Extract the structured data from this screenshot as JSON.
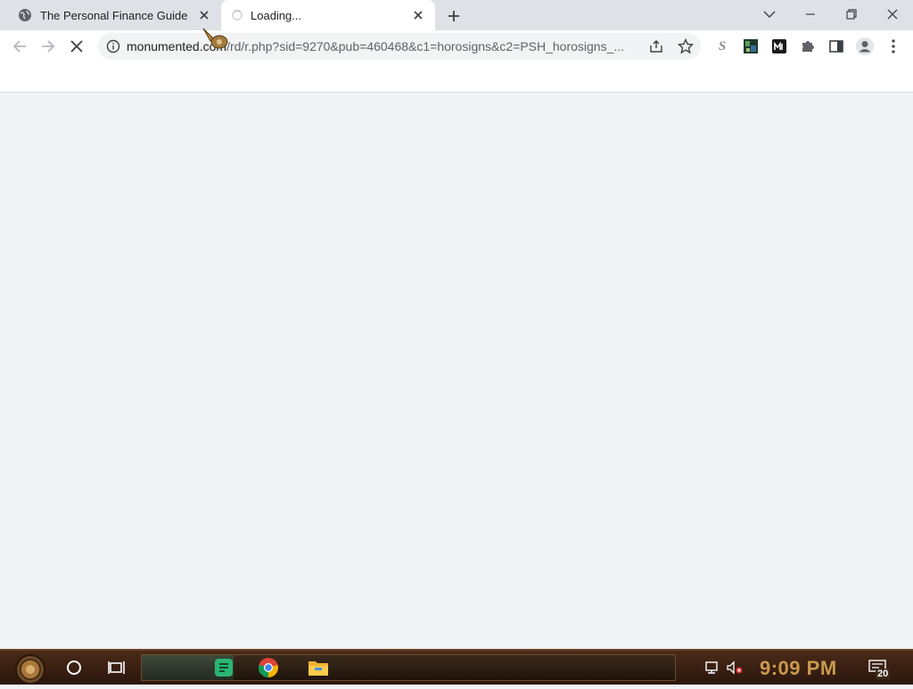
{
  "tabs": [
    {
      "title": "The Personal Finance Guide",
      "state": "inactive",
      "icon": "globe-icon"
    },
    {
      "title": "Loading...",
      "state": "active-loading",
      "icon": "loading-spinner"
    }
  ],
  "omnibox": {
    "host": "monumented.com",
    "path": "/rd/r.php?sid=9270&pub=460468&c1=horosigns&c2=PSH_horosigns_..."
  },
  "extensions": [
    "s-extension-icon",
    "image-extension-icon",
    "m-extension-icon",
    "puzzle-icon",
    "side-panel-icon",
    "profile-icon",
    "menu-icon"
  ],
  "taskbar": {
    "clock": "9:09 PM",
    "notification_count": "20"
  }
}
